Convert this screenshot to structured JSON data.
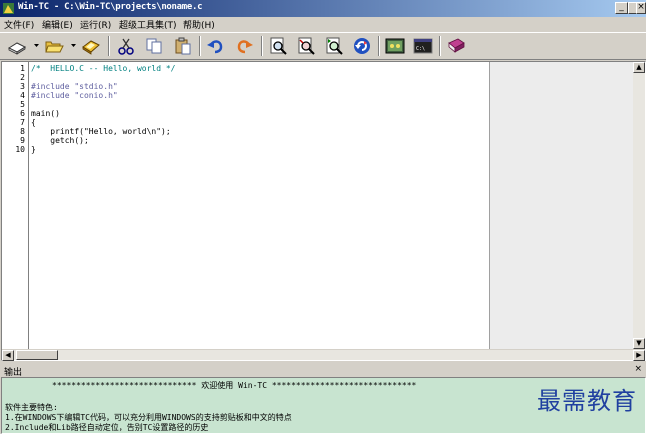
{
  "window": {
    "title": "Win-TC - C:\\Win-TC\\projects\\noname.c",
    "minimize": "_",
    "restore": "□",
    "close": "×"
  },
  "menu": [
    "文件(F)",
    "编辑(E)",
    "运行(R)",
    "超级工具集(T)",
    "帮助(H)"
  ],
  "toolbar": [
    "new-file-icon",
    "open-folder-icon",
    "save-icon",
    "cut-icon",
    "copy-icon",
    "paste-icon",
    "undo-icon",
    "redo-icon",
    "find-icon",
    "replace-icon",
    "find-next-icon",
    "refresh-icon",
    "compile-icon",
    "console-icon",
    "help-book-icon"
  ],
  "editor": {
    "line_numbers": [
      "1",
      "2",
      "3",
      "4",
      "5",
      "6",
      "7",
      "8",
      "9",
      "10"
    ],
    "lines": [
      "/*  HELLO.C -- Hello, world */",
      "",
      "#include \"stdio.h\"",
      "#include \"conio.h\"",
      "",
      "main()",
      "{",
      "    printf(\"Hello, world\\n\");",
      "    getch();",
      "}"
    ]
  },
  "output": {
    "label": "输出",
    "close": "×",
    "lines": [
      "****************************** 欢迎使用 Win-TC ******************************",
      "软件主要特色:",
      "1.在WINDOWS下编辑TC代码，可以充分利用WINDOWS的支持剪贴板和中文的特点",
      "2.Include和Lib路径自动定位，告别TC设置路径的历史"
    ]
  },
  "watermark": "最需教育"
}
